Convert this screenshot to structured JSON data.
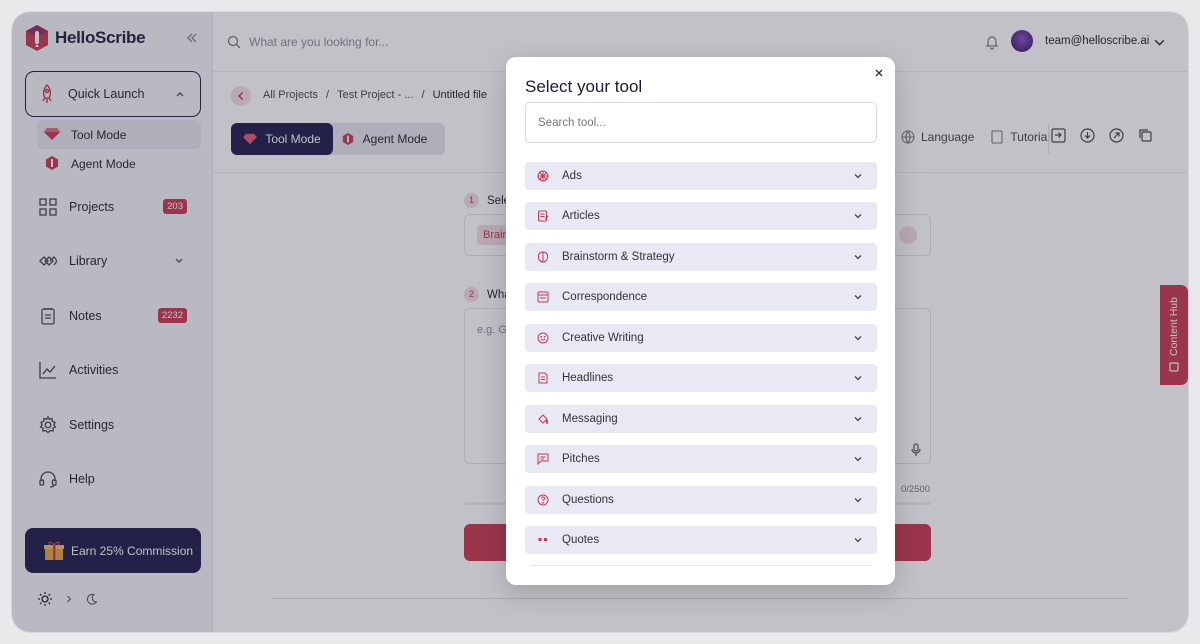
{
  "app": {
    "name": "HelloScribe"
  },
  "sidebar": {
    "quick_launch": "Quick Launch",
    "sub_items": [
      {
        "label": "Tool Mode",
        "active": true
      },
      {
        "label": "Agent Mode",
        "active": false
      }
    ],
    "nav": [
      {
        "label": "Projects",
        "badge": "203",
        "icon": "grid-icon"
      },
      {
        "label": "Library",
        "icon": "library-icon"
      },
      {
        "label": "Notes",
        "badge": "2232",
        "icon": "notes-icon"
      },
      {
        "label": "Activities",
        "icon": "activity-chart-icon"
      },
      {
        "label": "Settings",
        "icon": "gear-icon"
      },
      {
        "label": "Help",
        "icon": "headset-icon"
      }
    ],
    "earn": "Earn 25% Commission"
  },
  "header": {
    "search_placeholder": "What are you looking for...",
    "email": "team@helloscribe.ai"
  },
  "main": {
    "breadcrumbs": [
      "All Projects",
      "/",
      "Test Project - ...",
      "/",
      "Untitled file"
    ],
    "mode_tool": "Tool Mode",
    "mode_agent": "Agent Mode",
    "language": "Language",
    "tutorial": "Tutorial",
    "step1_num": "1",
    "step1": "Sele",
    "chip": "Brain",
    "step2_num": "2",
    "step2": "Wha",
    "textarea_placeholder": "e.g. Gi",
    "count": "0/2500",
    "content_hub": "Content Hub"
  },
  "modal": {
    "title": "Select your tool",
    "search_placeholder": "Search tool...",
    "categories": [
      {
        "label": "Ads",
        "icon": "ads-icon"
      },
      {
        "label": "Articles",
        "icon": "article-icon"
      },
      {
        "label": "Brainstorm & Strategy",
        "icon": "brain-icon"
      },
      {
        "label": "Correspondence",
        "icon": "mail-icon"
      },
      {
        "label": "Creative Writing",
        "icon": "smile-icon"
      },
      {
        "label": "Headlines",
        "icon": "document-icon"
      },
      {
        "label": "Messaging",
        "icon": "paint-bucket-icon"
      },
      {
        "label": "Pitches",
        "icon": "chat-icon"
      },
      {
        "label": "Questions",
        "icon": "question-icon"
      },
      {
        "label": "Quotes",
        "icon": "quote-icon"
      }
    ]
  },
  "colors": {
    "brand_dark": "#1e1a48",
    "accent": "#c8374f",
    "category_bg": "#e9e9f6"
  }
}
